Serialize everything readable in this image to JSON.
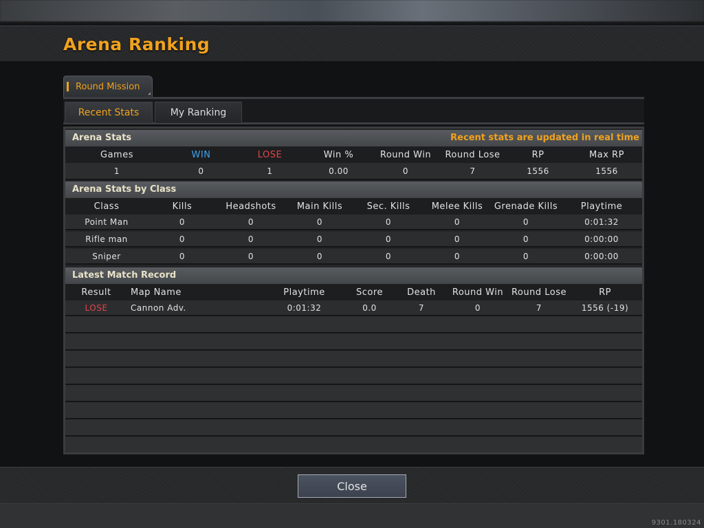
{
  "title": "Arena Ranking",
  "tabs": {
    "mission": "Round Mission",
    "recent": "Recent Stats",
    "ranking": "My Ranking"
  },
  "arena_stats": {
    "title": "Arena Stats",
    "note": "Recent stats are updated in real time",
    "headers": [
      "Games",
      "WIN",
      "LOSE",
      "Win %",
      "Round Win",
      "Round Lose",
      "RP",
      "Max RP"
    ],
    "values": [
      "1",
      "0",
      "1",
      "0.00",
      "0",
      "7",
      "1556",
      "1556"
    ]
  },
  "class_stats": {
    "title": "Arena Stats by Class",
    "headers": [
      "Class",
      "Kills",
      "Headshots",
      "Main Kills",
      "Sec. Kills",
      "Melee Kills",
      "Grenade Kills",
      "Playtime"
    ],
    "rows": [
      [
        "Point Man",
        "0",
        "0",
        "0",
        "0",
        "0",
        "0",
        "0:01:32"
      ],
      [
        "Rifle man",
        "0",
        "0",
        "0",
        "0",
        "0",
        "0",
        "0:00:00"
      ],
      [
        "Sniper",
        "0",
        "0",
        "0",
        "0",
        "0",
        "0",
        "0:00:00"
      ]
    ]
  },
  "match_record": {
    "title": "Latest Match Record",
    "headers": [
      "Result",
      "Map Name",
      "Playtime",
      "Score",
      "Death",
      "Round Win",
      "Round Lose",
      "RP"
    ],
    "rows": [
      [
        "LOSE",
        "Cannon Adv.",
        "0:01:32",
        "0.0",
        "7",
        "0",
        "7",
        "1556 (-19)"
      ]
    ]
  },
  "close_label": "Close",
  "build_id": "9301.180324",
  "colors": {
    "accent": "#f0a21f",
    "win": "#3ea3ef",
    "lose": "#e0464c"
  }
}
